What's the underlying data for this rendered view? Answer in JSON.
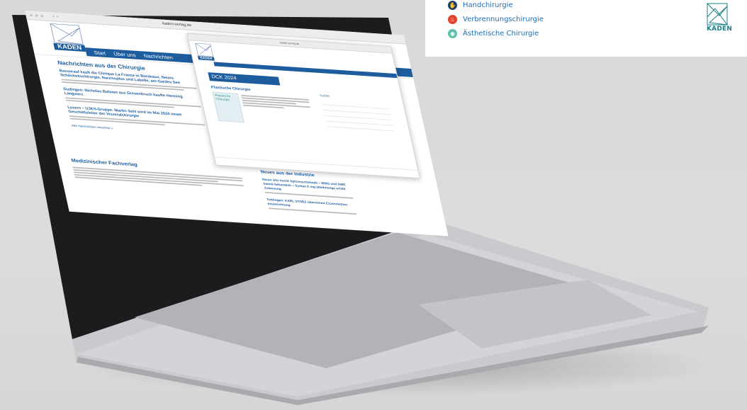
{
  "legend": {
    "items": [
      {
        "label": "Handchirurgie",
        "icon": "hand-icon",
        "color": "#1d3f6e"
      },
      {
        "label": "Verbrennungschirurgie",
        "icon": "flame-icon",
        "color": "#e2432a"
      },
      {
        "label": "Ästhetische Chirurgie",
        "icon": "eye-icon",
        "color": "#5fbfa8"
      }
    ],
    "logo_text": "KADEN"
  },
  "laptop_screen": {
    "url": "kaden-verlag.de",
    "logo_text": "KADEN",
    "nav": [
      "Start",
      "Über uns",
      "Nachrichten"
    ],
    "news_heading": "Nachrichten aus der Chirurgie",
    "news": [
      {
        "title": "Bassorauf kauft die Clinique La France in Bordeaux, Neues Schönheitschirurgie, Narzissplus und Labelle, am Gardes See"
      },
      {
        "title": "Dudingen: Nicholas Bahnen aus Grevenbruch kaufte Henning Langwerz"
      },
      {
        "title": "Luzern – UJKS-Gruppe: Martin Sehl wird im Mai 2024 neuer Geschäftsleiter der Viszeralchirurgie"
      }
    ],
    "all_news_link": "Alle Nachrichten ansehen »",
    "publisher_heading": "Medizinischer Fachverlag",
    "industry_heading": "Neues aus der Industrie",
    "industry": [
      {
        "title": "Neuer Sitz hocht Spitzenschmiede – MWS und DWE Sanitä behandeln – Syntax E ing ablehnungs erhält Zulassung"
      },
      {
        "title": "Tuttlingen: KARL STORZ übernimmt Exzenmetizer Innenrichtung"
      }
    ],
    "inner_window": {
      "title": "kaden-verlag.de",
      "banner": "DCK 2024",
      "heading": "Plastische Chirurgie",
      "book_title": "Plastische Chirurgie",
      "sidebar_heading": "Suche"
    }
  }
}
